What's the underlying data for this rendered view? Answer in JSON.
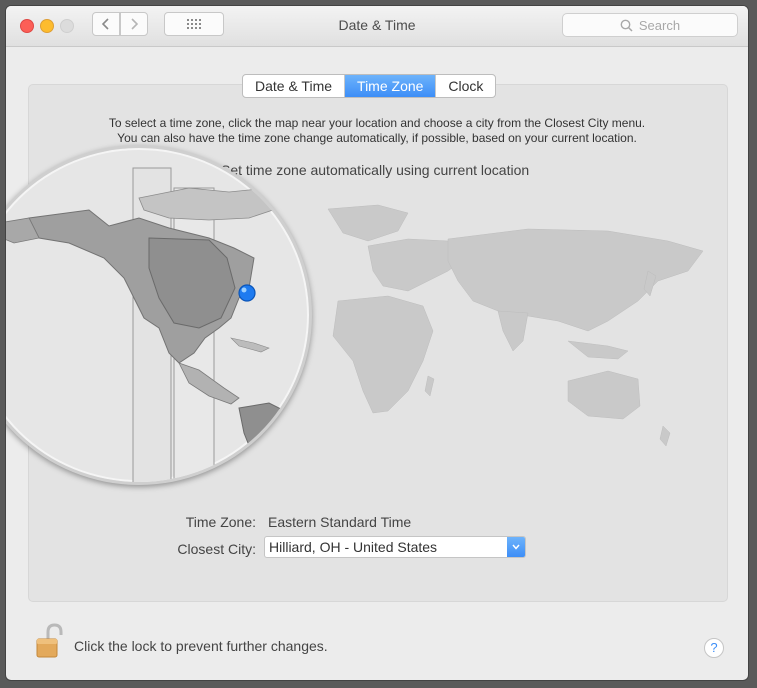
{
  "window": {
    "title": "Date & Time"
  },
  "toolbar": {
    "back_icon": "chevron-left-icon",
    "forward_icon": "chevron-right-icon",
    "grid_icon": "grid-icon"
  },
  "search": {
    "placeholder": "Search"
  },
  "tabs": [
    {
      "label": "Date & Time",
      "active": false
    },
    {
      "label": "Time Zone",
      "active": true
    },
    {
      "label": "Clock",
      "active": false
    }
  ],
  "timezone": {
    "instructions_line1": "To select a time zone, click the map near your location and choose a city from the Closest City menu.",
    "instructions_line2": "You can also have the time zone change automatically, if possible, based on your current location.",
    "auto_label": "Set time zone automatically using current location",
    "tz_label": "Time Zone:",
    "tz_value": "Eastern Standard Time",
    "city_label": "Closest City:",
    "city_value": "Hilliard, OH - United States"
  },
  "footer": {
    "lock_text": "Click the lock to prevent further changes.",
    "help_label": "?"
  },
  "colors": {
    "accent": "#3d8ef7",
    "pin": "#1e7bf0"
  }
}
